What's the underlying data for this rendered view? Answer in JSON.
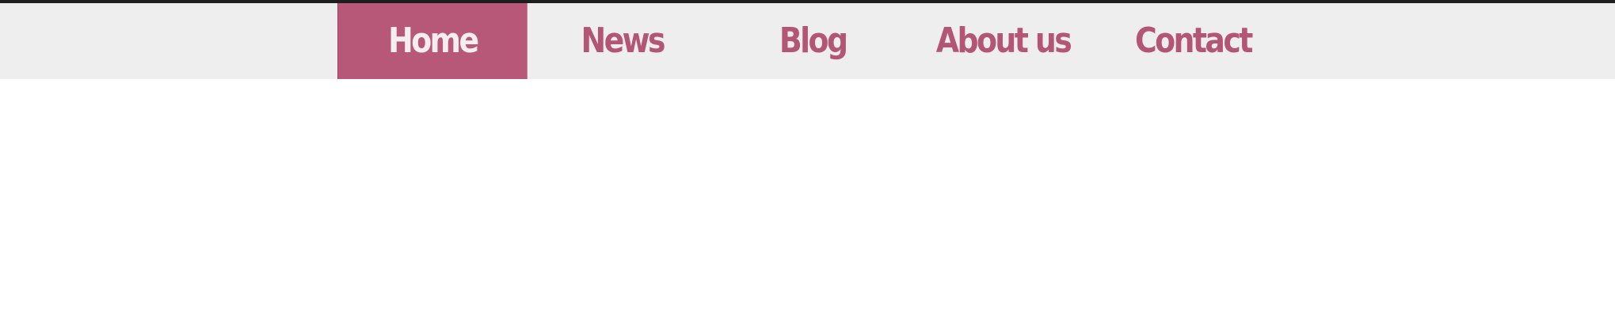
{
  "nav": {
    "accent_color": "#b85879",
    "background_color": "#eeeeee",
    "items": [
      {
        "label": "Home",
        "active": true
      },
      {
        "label": "News",
        "active": false
      },
      {
        "label": "Blog",
        "active": false
      },
      {
        "label": "About us",
        "active": false
      },
      {
        "label": "Contact",
        "active": false
      }
    ]
  }
}
